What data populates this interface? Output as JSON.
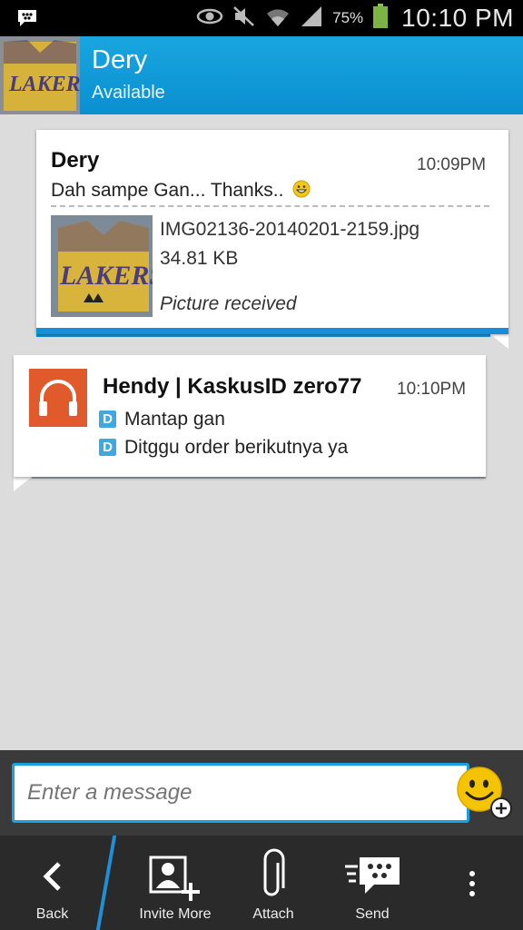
{
  "status_bar": {
    "battery_percent": "75%",
    "time": "10:10 PM",
    "icons": [
      "bbm-icon",
      "eye-icon",
      "mute-icon",
      "wifi-icon",
      "signal-icon",
      "battery-icon"
    ]
  },
  "header": {
    "contact_name": "Dery",
    "contact_status": "Available"
  },
  "messages": [
    {
      "sender": "Dery",
      "time": "10:09PM",
      "text": "Dah sampe Gan... Thanks..",
      "attachment": {
        "file_name": "IMG02136-20140201-2159.jpg",
        "file_size": "34.81 KB",
        "status": "Picture received"
      }
    },
    {
      "sender": "Hendy | KaskusID zero77",
      "time": "10:10PM",
      "lines": [
        "Mantap gan",
        "Ditggu order berikutnya ya"
      ],
      "badge": "D"
    }
  ],
  "compose": {
    "placeholder": "Enter a message"
  },
  "toolbar": {
    "back": "Back",
    "invite": "Invite More",
    "attach": "Attach",
    "send": "Send"
  },
  "colors": {
    "header_blue": "#0a8fd0",
    "accent_blue": "#1391d2",
    "contact_icon": "#e05a2b"
  }
}
